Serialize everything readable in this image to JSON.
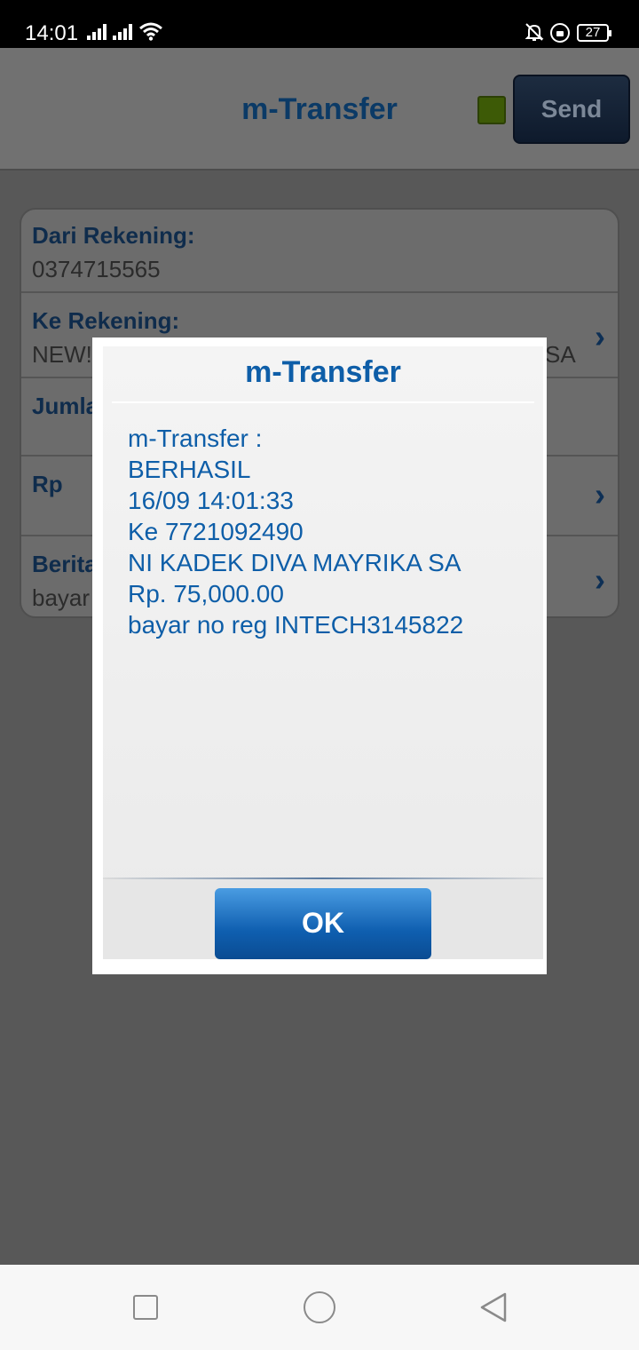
{
  "status_bar": {
    "time": "14:01",
    "battery": "27",
    "icons": [
      "signal-icon",
      "signal-icon",
      "wifi-icon",
      "bell-muted-icon",
      "lock-rotation-icon",
      "battery-icon"
    ]
  },
  "header": {
    "title": "m-Transfer",
    "send_label": "Send",
    "indicator_color": "#3d5a06"
  },
  "form": {
    "rows": [
      {
        "label": "Dari Rekening:",
        "value": "0374715565"
      },
      {
        "label": "Ke Rekening:",
        "value": "NEW!",
        "value_right": "SA"
      },
      {
        "label": "Jumla",
        "value": ""
      },
      {
        "label": "Rp",
        "value": ""
      },
      {
        "label": "Berita",
        "value": "bayar"
      }
    ]
  },
  "dialog": {
    "title": "m-Transfer",
    "lines": [
      "m-Transfer :",
      "BERHASIL",
      "16/09 14:01:33",
      "Ke 7721092490",
      "NI KADEK DIVA MAYRIKA SA",
      "Rp. 75,000.00",
      "bayar no reg INTECH3145822"
    ],
    "ok_label": "OK"
  },
  "colors": {
    "accent": "#0e5ea8",
    "header_title": "#0b3a66"
  }
}
